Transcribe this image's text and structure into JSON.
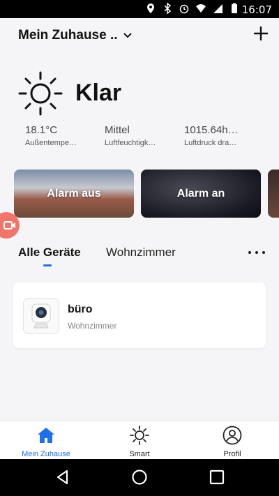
{
  "statusbar": {
    "time": "16:07"
  },
  "header": {
    "home_name": "Mein Zuhause .."
  },
  "weather": {
    "condition": "Klar",
    "stats": [
      {
        "value": "18.1°C",
        "label": "Außentempe…"
      },
      {
        "value": "Mittel",
        "label": "Luftfeuchtigk…"
      },
      {
        "value": "1015.64h…",
        "label": "Luftdruck dra…"
      }
    ]
  },
  "scenes": [
    {
      "label": "Alarm aus"
    },
    {
      "label": "Alarm an"
    }
  ],
  "tabs": {
    "all": "Alle Geräte",
    "room": "Wohnzimmer"
  },
  "devices": [
    {
      "name": "büro",
      "room": "Wohnzimmer"
    }
  ],
  "tabbar": {
    "items": [
      {
        "label": "Mein Zuhause",
        "icon": "home-icon"
      },
      {
        "label": "Smart",
        "icon": "sun-icon"
      },
      {
        "label": "Profil",
        "icon": "user-icon"
      }
    ]
  },
  "colors": {
    "accent": "#1e6fe8",
    "float_button": "#f0766b"
  }
}
